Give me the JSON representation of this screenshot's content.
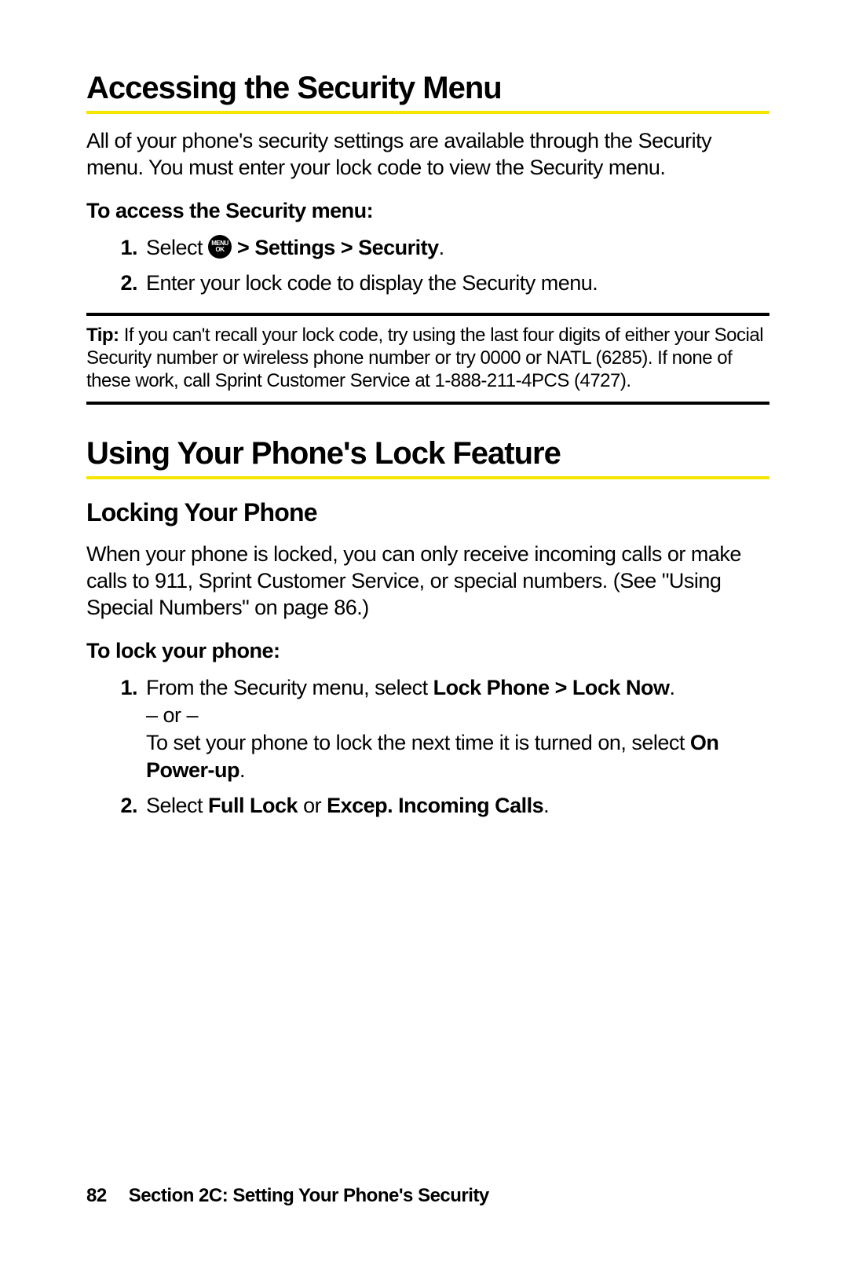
{
  "section1": {
    "heading": "Accessing the Security Menu",
    "intro": "All of your phone's security settings are available through the Security menu. You must enter your lock code to view the Security menu.",
    "subhead": "To access the Security menu:",
    "step1_prefix": "Select ",
    "step1_suffix": " > Settings > Security",
    "step1_period": ".",
    "step2": "Enter your lock code to display the Security menu.",
    "menu_icon_top": "MENU",
    "menu_icon_bottom": "OK"
  },
  "tip": {
    "label": "Tip:",
    "text": " If you can't recall your lock code, try using the last four digits of either your Social Security number or wireless phone number or try 0000 or NATL (6285). If none of these work, call Sprint Customer Service at 1-888-211-4PCS (4727)."
  },
  "section2": {
    "heading": "Using Your Phone's Lock Feature",
    "sub1": "Locking Your Phone",
    "intro": "When your phone is locked, you can only receive incoming calls or make calls to 911, Sprint Customer Service, or special numbers. (See \"Using Special Numbers\" on page 86.)",
    "subhead": "To lock your phone:",
    "step1_a": "From the Security menu, select ",
    "step1_b": "Lock Phone > Lock Now",
    "step1_c": ". – or – To set your phone to lock the next time it is turned on, select ",
    "step1_d": "On Power-up",
    "step1_e": ".",
    "step2_a": "Select ",
    "step2_b": "Full Lock",
    "step2_c": " or ",
    "step2_d": "Excep. Incoming Calls",
    "step2_e": "."
  },
  "footer": {
    "page": "82",
    "section": "Section 2C: Setting Your Phone's Security"
  }
}
